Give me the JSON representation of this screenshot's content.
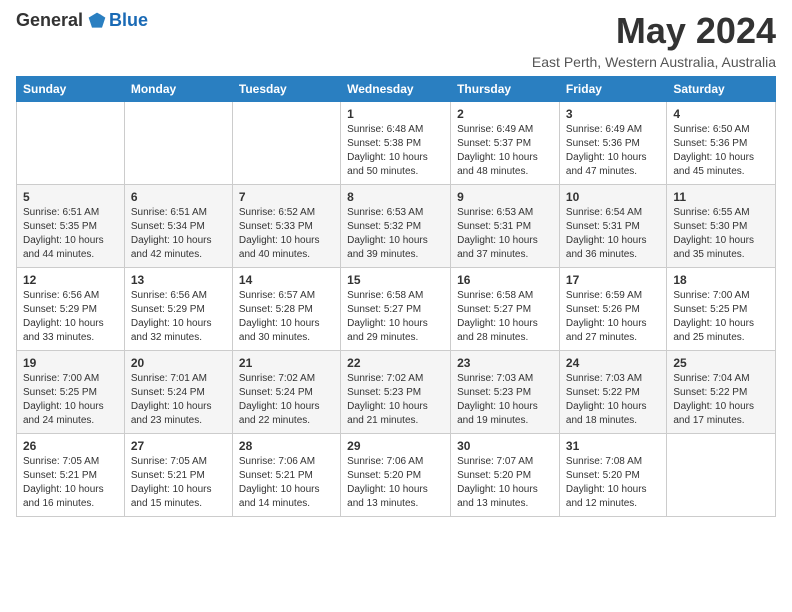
{
  "header": {
    "logo_general": "General",
    "logo_blue": "Blue",
    "title": "May 2024",
    "subtitle": "East Perth, Western Australia, Australia"
  },
  "calendar": {
    "days_of_week": [
      "Sunday",
      "Monday",
      "Tuesday",
      "Wednesday",
      "Thursday",
      "Friday",
      "Saturday"
    ],
    "weeks": [
      [
        {
          "day": "",
          "info": ""
        },
        {
          "day": "",
          "info": ""
        },
        {
          "day": "",
          "info": ""
        },
        {
          "day": "1",
          "info": "Sunrise: 6:48 AM\nSunset: 5:38 PM\nDaylight: 10 hours\nand 50 minutes."
        },
        {
          "day": "2",
          "info": "Sunrise: 6:49 AM\nSunset: 5:37 PM\nDaylight: 10 hours\nand 48 minutes."
        },
        {
          "day": "3",
          "info": "Sunrise: 6:49 AM\nSunset: 5:36 PM\nDaylight: 10 hours\nand 47 minutes."
        },
        {
          "day": "4",
          "info": "Sunrise: 6:50 AM\nSunset: 5:36 PM\nDaylight: 10 hours\nand 45 minutes."
        }
      ],
      [
        {
          "day": "5",
          "info": "Sunrise: 6:51 AM\nSunset: 5:35 PM\nDaylight: 10 hours\nand 44 minutes."
        },
        {
          "day": "6",
          "info": "Sunrise: 6:51 AM\nSunset: 5:34 PM\nDaylight: 10 hours\nand 42 minutes."
        },
        {
          "day": "7",
          "info": "Sunrise: 6:52 AM\nSunset: 5:33 PM\nDaylight: 10 hours\nand 40 minutes."
        },
        {
          "day": "8",
          "info": "Sunrise: 6:53 AM\nSunset: 5:32 PM\nDaylight: 10 hours\nand 39 minutes."
        },
        {
          "day": "9",
          "info": "Sunrise: 6:53 AM\nSunset: 5:31 PM\nDaylight: 10 hours\nand 37 minutes."
        },
        {
          "day": "10",
          "info": "Sunrise: 6:54 AM\nSunset: 5:31 PM\nDaylight: 10 hours\nand 36 minutes."
        },
        {
          "day": "11",
          "info": "Sunrise: 6:55 AM\nSunset: 5:30 PM\nDaylight: 10 hours\nand 35 minutes."
        }
      ],
      [
        {
          "day": "12",
          "info": "Sunrise: 6:56 AM\nSunset: 5:29 PM\nDaylight: 10 hours\nand 33 minutes."
        },
        {
          "day": "13",
          "info": "Sunrise: 6:56 AM\nSunset: 5:29 PM\nDaylight: 10 hours\nand 32 minutes."
        },
        {
          "day": "14",
          "info": "Sunrise: 6:57 AM\nSunset: 5:28 PM\nDaylight: 10 hours\nand 30 minutes."
        },
        {
          "day": "15",
          "info": "Sunrise: 6:58 AM\nSunset: 5:27 PM\nDaylight: 10 hours\nand 29 minutes."
        },
        {
          "day": "16",
          "info": "Sunrise: 6:58 AM\nSunset: 5:27 PM\nDaylight: 10 hours\nand 28 minutes."
        },
        {
          "day": "17",
          "info": "Sunrise: 6:59 AM\nSunset: 5:26 PM\nDaylight: 10 hours\nand 27 minutes."
        },
        {
          "day": "18",
          "info": "Sunrise: 7:00 AM\nSunset: 5:25 PM\nDaylight: 10 hours\nand 25 minutes."
        }
      ],
      [
        {
          "day": "19",
          "info": "Sunrise: 7:00 AM\nSunset: 5:25 PM\nDaylight: 10 hours\nand 24 minutes."
        },
        {
          "day": "20",
          "info": "Sunrise: 7:01 AM\nSunset: 5:24 PM\nDaylight: 10 hours\nand 23 minutes."
        },
        {
          "day": "21",
          "info": "Sunrise: 7:02 AM\nSunset: 5:24 PM\nDaylight: 10 hours\nand 22 minutes."
        },
        {
          "day": "22",
          "info": "Sunrise: 7:02 AM\nSunset: 5:23 PM\nDaylight: 10 hours\nand 21 minutes."
        },
        {
          "day": "23",
          "info": "Sunrise: 7:03 AM\nSunset: 5:23 PM\nDaylight: 10 hours\nand 19 minutes."
        },
        {
          "day": "24",
          "info": "Sunrise: 7:03 AM\nSunset: 5:22 PM\nDaylight: 10 hours\nand 18 minutes."
        },
        {
          "day": "25",
          "info": "Sunrise: 7:04 AM\nSunset: 5:22 PM\nDaylight: 10 hours\nand 17 minutes."
        }
      ],
      [
        {
          "day": "26",
          "info": "Sunrise: 7:05 AM\nSunset: 5:21 PM\nDaylight: 10 hours\nand 16 minutes."
        },
        {
          "day": "27",
          "info": "Sunrise: 7:05 AM\nSunset: 5:21 PM\nDaylight: 10 hours\nand 15 minutes."
        },
        {
          "day": "28",
          "info": "Sunrise: 7:06 AM\nSunset: 5:21 PM\nDaylight: 10 hours\nand 14 minutes."
        },
        {
          "day": "29",
          "info": "Sunrise: 7:06 AM\nSunset: 5:20 PM\nDaylight: 10 hours\nand 13 minutes."
        },
        {
          "day": "30",
          "info": "Sunrise: 7:07 AM\nSunset: 5:20 PM\nDaylight: 10 hours\nand 13 minutes."
        },
        {
          "day": "31",
          "info": "Sunrise: 7:08 AM\nSunset: 5:20 PM\nDaylight: 10 hours\nand 12 minutes."
        },
        {
          "day": "",
          "info": ""
        }
      ]
    ]
  }
}
